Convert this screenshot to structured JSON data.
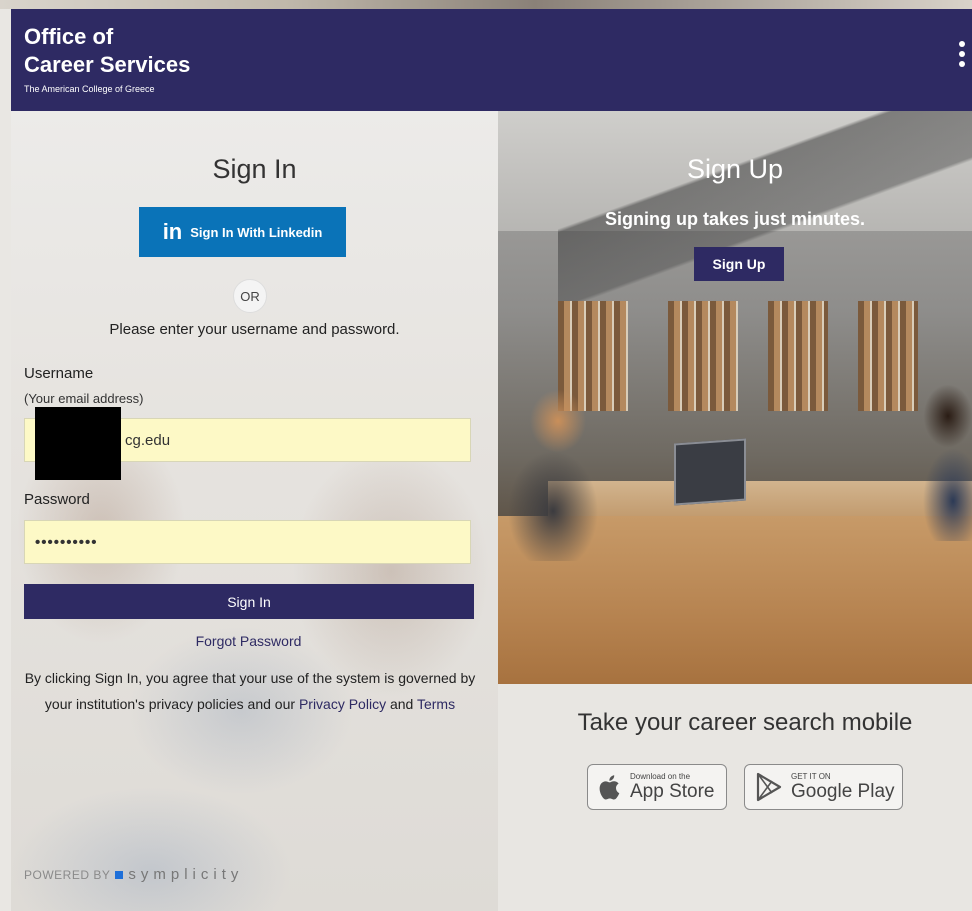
{
  "header": {
    "brand_line1": "Office of",
    "brand_line2": "Career Services",
    "brand_line3": "The American College of Greece",
    "menu_icon": "kebab-menu-icon"
  },
  "signin": {
    "title": "Sign In",
    "linkedin_icon": "linkedin-in-icon",
    "linkedin_label": "Sign In With Linkedin",
    "or_label": "OR",
    "instructions": "Please enter your username and password.",
    "username_label": "Username",
    "username_hint": "(Your email address)",
    "username_value": "cg.edu",
    "password_label": "Password",
    "password_value": "••••••••••",
    "submit_label": "Sign In",
    "forgot_label": "Forgot Password",
    "legal_text": "By clicking Sign In, you agree that your use of the system is governed by your institution's privacy policies and our",
    "privacy_link": "Privacy Policy",
    "and_text": "and",
    "terms_link": "Terms"
  },
  "footer": {
    "powered_by": "POWERED BY",
    "brand": "symplicity"
  },
  "signup": {
    "title": "Sign Up",
    "subtitle": "Signing up takes just minutes.",
    "button_label": "Sign Up"
  },
  "mobile": {
    "heading": "Take your career search mobile",
    "appstore_small": "Download on the",
    "appstore_large": "App Store",
    "appstore_icon": "apple-icon",
    "gplay_small": "GET IT ON",
    "gplay_large": "Google Play",
    "gplay_icon": "google-play-icon"
  },
  "colors": {
    "brand": "#2e2a63",
    "linkedin": "#0a73b8",
    "input_bg": "#fdf9c6"
  }
}
